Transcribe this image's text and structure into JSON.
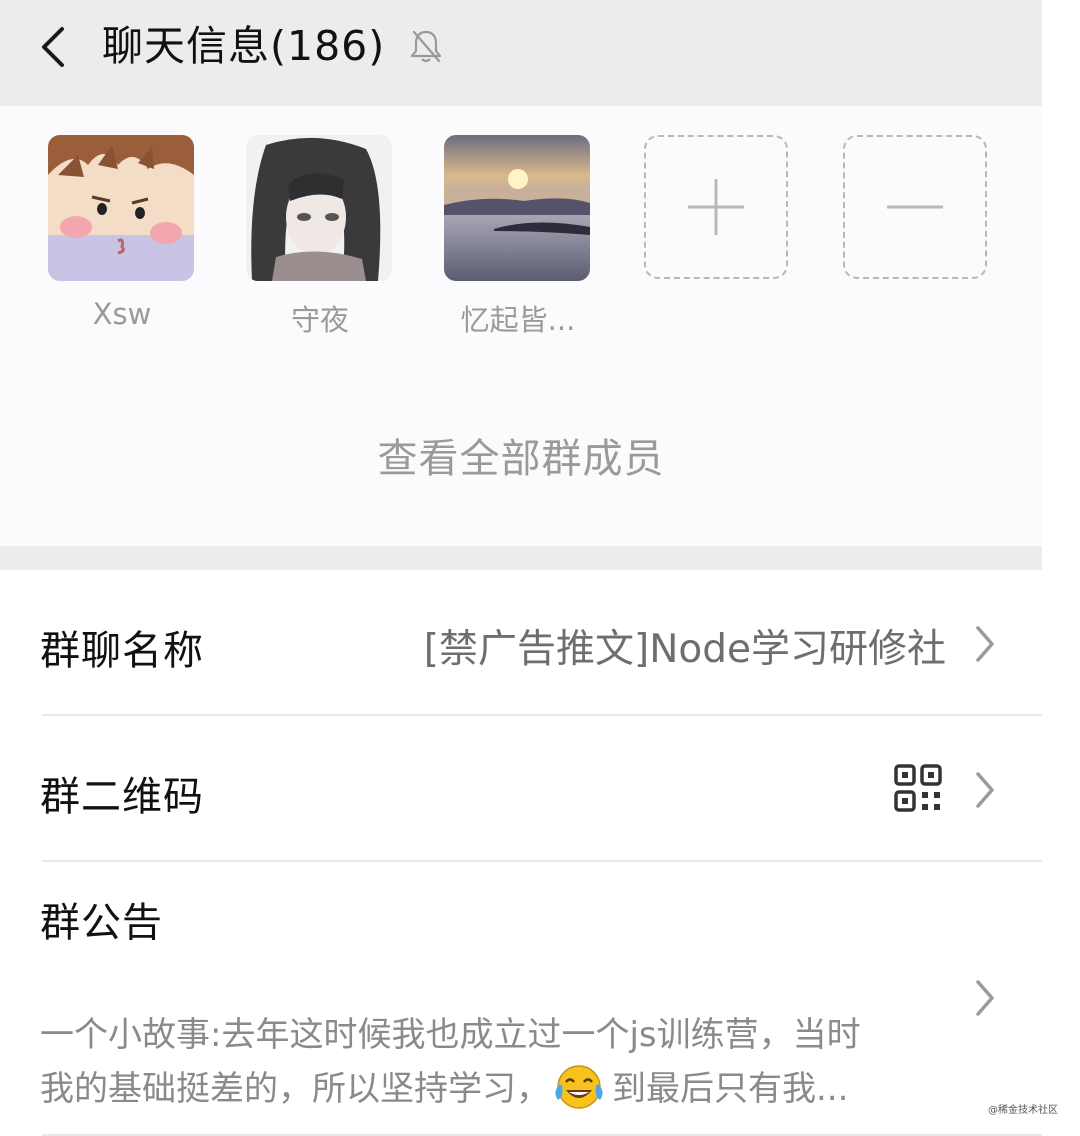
{
  "header": {
    "title": "聊天信息(186)"
  },
  "members": {
    "items": [
      {
        "name": "Xsw"
      },
      {
        "name": "守夜"
      },
      {
        "name": "忆起皆..."
      }
    ],
    "view_all": "查看全部群成员"
  },
  "settings": {
    "group_name_label": "群聊名称",
    "group_name_value": "[禁广告推文]Node学习研修社",
    "qr_label": "群二维码",
    "notice_label": "群公告",
    "notice_text_1": "一个小故事:去年这时候我也成立过一个js训练营，当时",
    "notice_text_2a": "我的基础挺差的，所以坚持学习，",
    "notice_text_2b": "到最后只有我..."
  },
  "watermark": "@稀金技术社区",
  "colors": {
    "header_bg": "#ececec",
    "muted_text": "#9a9a9a"
  }
}
